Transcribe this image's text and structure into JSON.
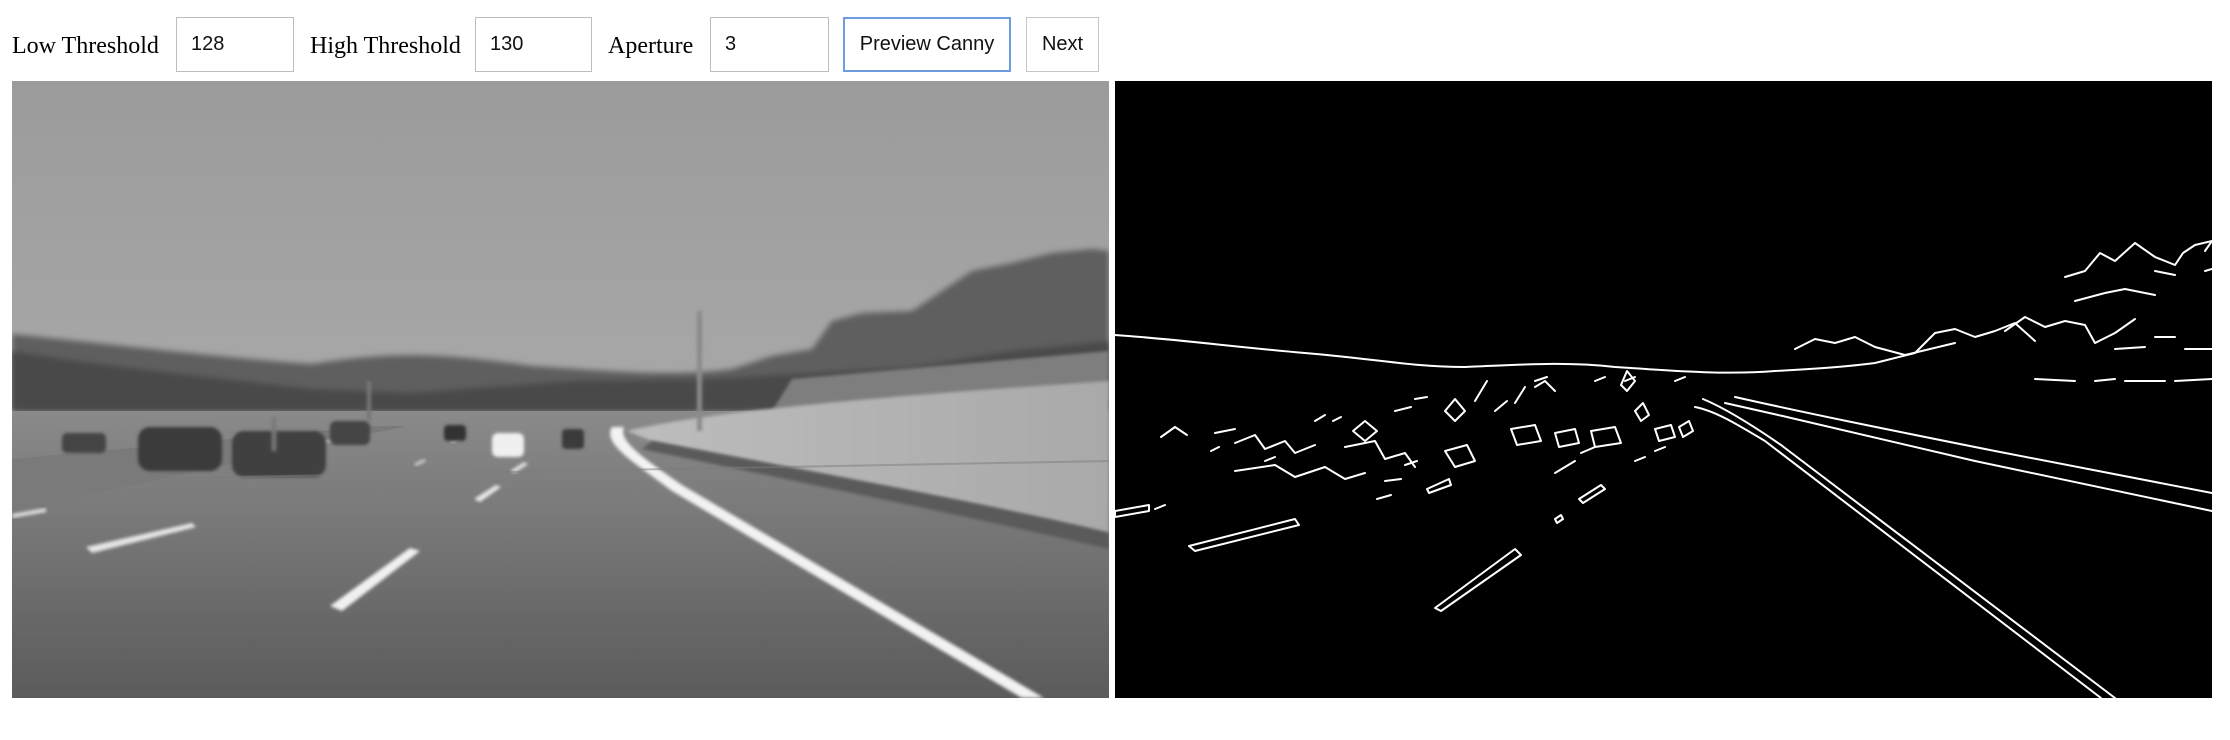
{
  "controls": {
    "low_threshold": {
      "label": "Low Threshold",
      "value": "128"
    },
    "high_threshold": {
      "label": "High Threshold",
      "value": "130"
    },
    "aperture": {
      "label": "Aperture",
      "value": "3"
    },
    "preview_button": "Preview Canny",
    "next_button": "Next"
  },
  "colors": {
    "focus_border": "#6e9ddf",
    "edge_background": "#000000",
    "edge_lines": "#ffffff"
  },
  "images": {
    "source": {
      "kind": "grayscale-blurred-road-photo"
    },
    "edges": {
      "kind": "canny-edge-map"
    }
  }
}
